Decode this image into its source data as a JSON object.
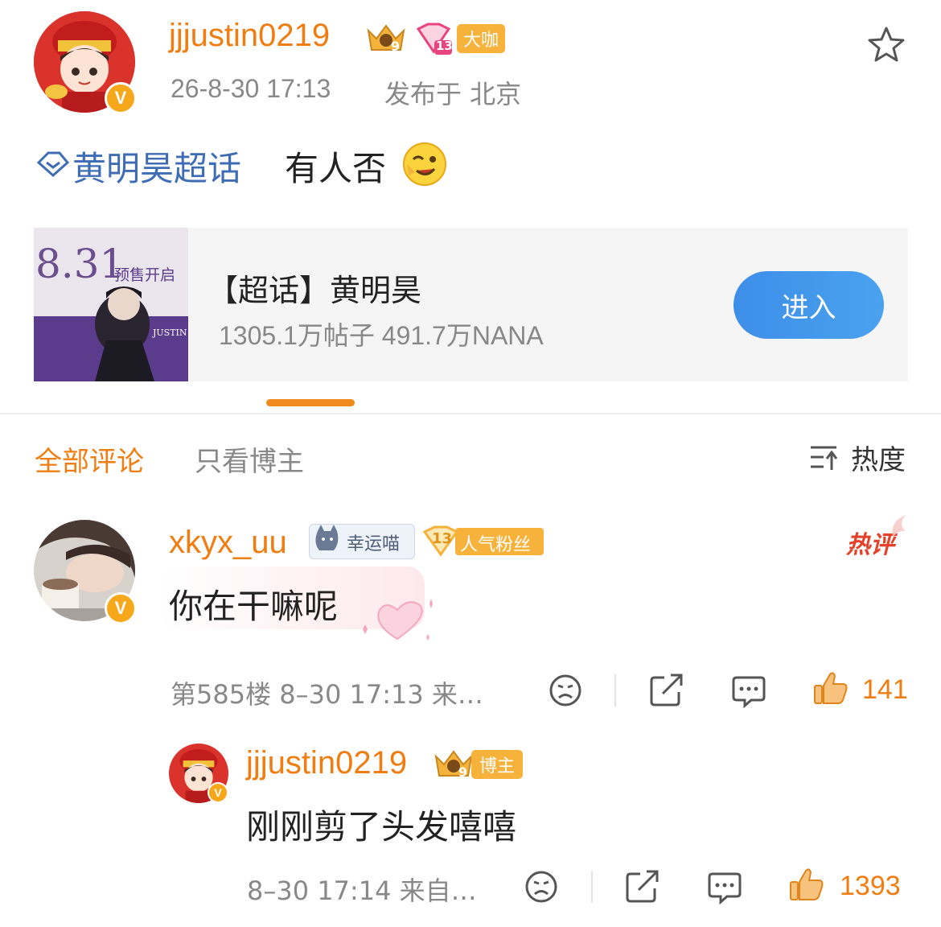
{
  "post": {
    "author": "jjjustin0219",
    "crown_level": "9",
    "diamond_level": "13",
    "badge": "大咖",
    "time": "26-8-30 17:13",
    "location": "发布于 北京",
    "topic": "黄明昊超话",
    "text": "有人否",
    "emoji": "wink-face"
  },
  "card": {
    "title": "【超话】黄明昊",
    "stats": "1305.1万帖子 491.7万NANA",
    "button": "进入",
    "poster_date": "8.31",
    "poster_sub": "预售开启",
    "poster_name": "JUSTIN"
  },
  "tabs": {
    "all": "全部评论",
    "author_only": "只看博主",
    "sort": "热度"
  },
  "comment": {
    "user": "xkyx_uu",
    "badge1": "幸运喵",
    "fan_level": "13",
    "badge2": "人气粉丝",
    "hot_label": "热评",
    "text": "你在干嘛呢",
    "meta": "第585楼 8–30 17:13 来…",
    "likes": "141"
  },
  "reply": {
    "user": "jjjustin0219",
    "crown_level": "9",
    "badge": "博主",
    "text": "刚刚剪了头发嘻嘻",
    "meta": "8–30 17:14 来自…",
    "likes": "1393"
  },
  "colors": {
    "orange": "#ef7d12",
    "blue_link": "#3f6db5",
    "button_blue": "#3d8ee8",
    "gold_badge": "#f6b23a"
  }
}
